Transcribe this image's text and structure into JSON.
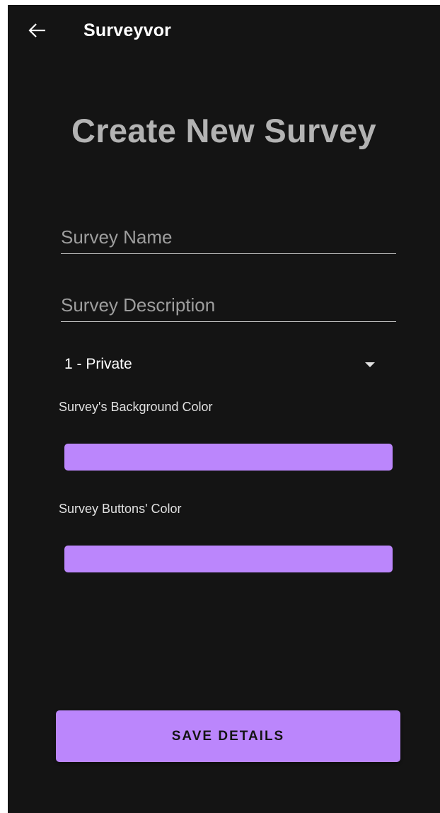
{
  "app_bar": {
    "title": "Surveyvor",
    "back_icon": "arrow-left-icon"
  },
  "page": {
    "title": "Create New Survey"
  },
  "form": {
    "survey_name": {
      "value": "",
      "placeholder": "Survey Name"
    },
    "survey_description": {
      "value": "",
      "placeholder": "Survey Description"
    },
    "privacy_dropdown": {
      "selected": "1 - Private",
      "icon": "caret-down-icon"
    },
    "background_color": {
      "label": "Survey's Background Color",
      "color": "#bb86fc"
    },
    "buttons_color": {
      "label": "Survey Buttons' Color",
      "color": "#bb86fc"
    },
    "save_button": {
      "label": "SAVE DETAILS",
      "color": "#bb86fc"
    }
  },
  "theme": {
    "background": "#141414",
    "accent": "#bb86fc"
  }
}
